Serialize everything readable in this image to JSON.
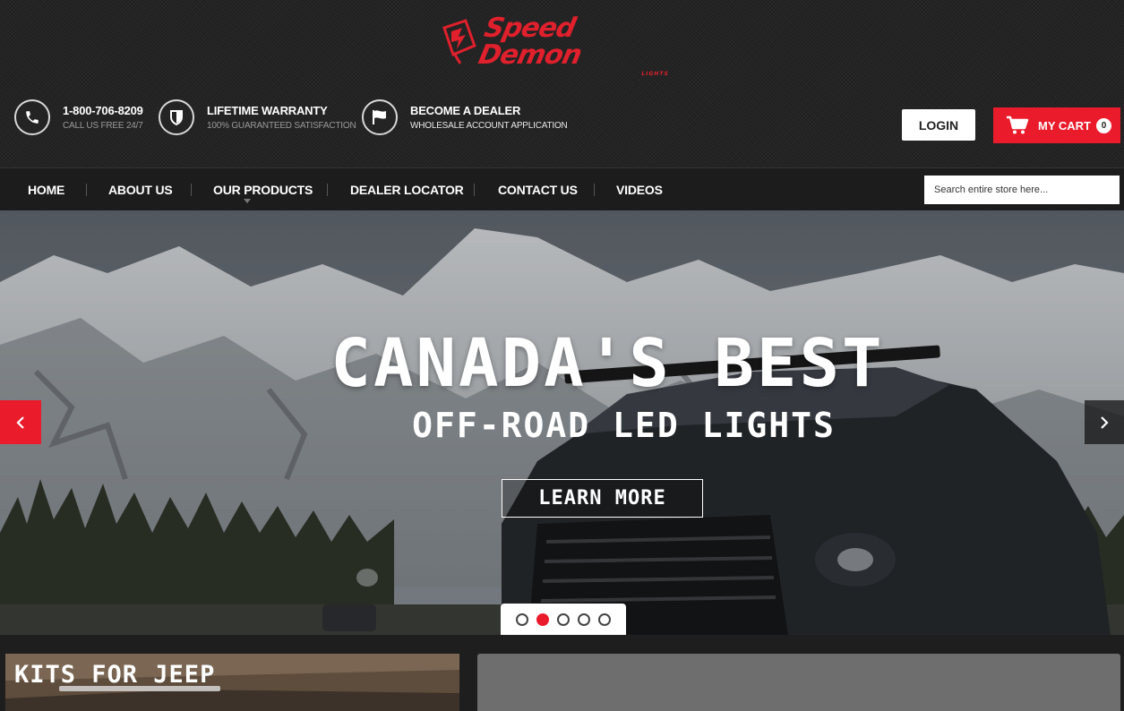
{
  "brand": {
    "name": "Speed Demon",
    "sub": "LIGHTS",
    "color": "#ea1b2b"
  },
  "header": {
    "phone": {
      "title": "1-800-706-8209",
      "sub": "CALL US FREE 24/7",
      "icon": "phone-icon"
    },
    "warranty": {
      "title": "LIFETIME WARRANTY",
      "sub": "100% GUARANTEED SATISFACTION",
      "icon": "shield-icon"
    },
    "dealer": {
      "title": "BECOME A DEALER",
      "sub": "WHOLESALE ACCOUNT APPLICATION",
      "icon": "flag-icon"
    },
    "login_label": "LOGIN",
    "cart_label": "MY CART",
    "cart_count": "0"
  },
  "nav": {
    "items": [
      "HOME",
      "ABOUT US",
      "OUR PRODUCTS",
      "DEALER LOCATOR",
      "CONTACT US",
      "VIDEOS"
    ],
    "search_placeholder": "Search entire store here..."
  },
  "hero": {
    "title": "CANADA'S BEST",
    "subtitle": "OFF-ROAD LED LIGHTS",
    "button_label": "LEARN MORE",
    "slide_count": 5,
    "active_slide": 2
  },
  "promos": {
    "left_title": "KITS FOR JEEP"
  }
}
